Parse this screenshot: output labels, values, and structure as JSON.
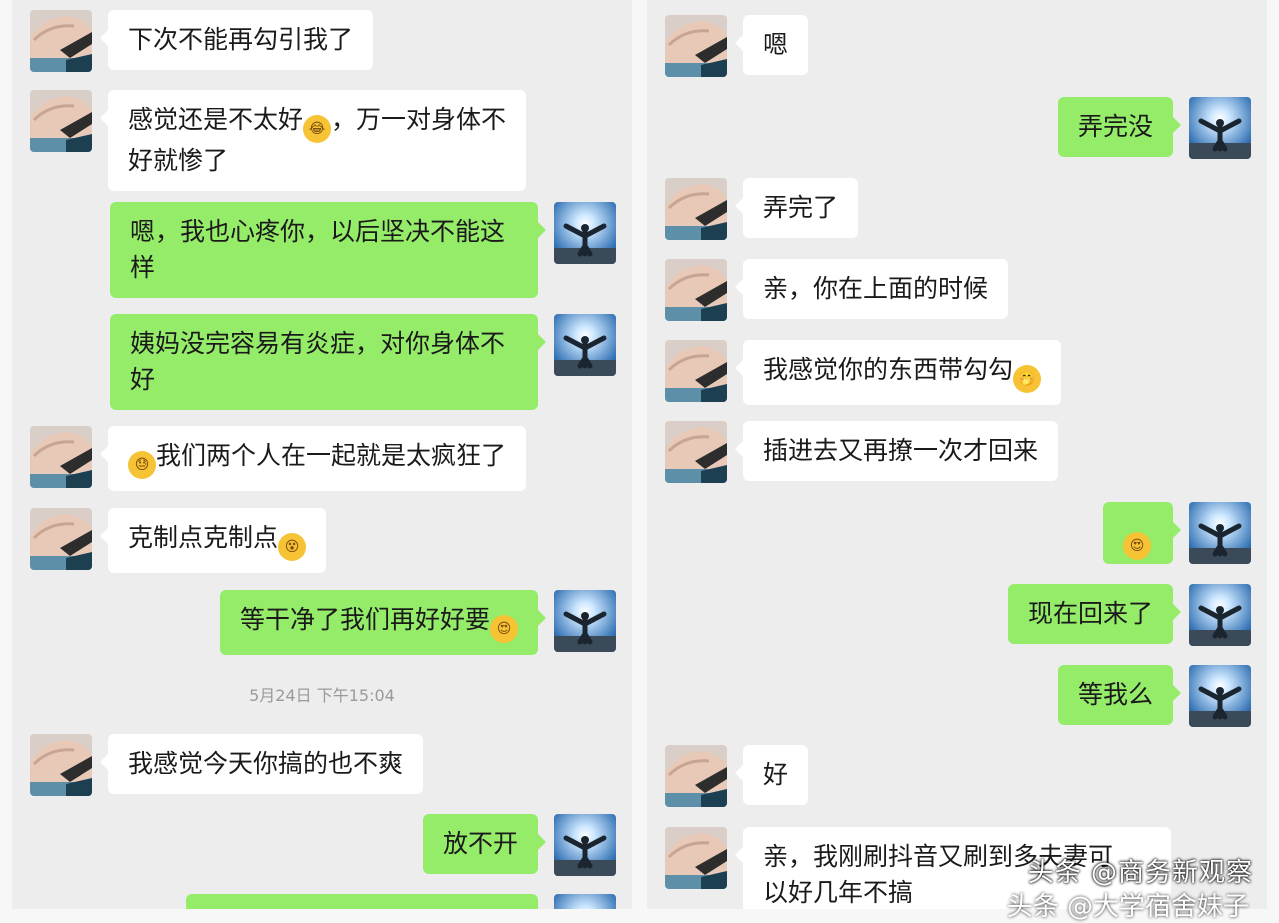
{
  "left": {
    "messages": [
      {
        "dir": "in",
        "text": "下次不能再勾引我了"
      },
      {
        "dir": "in",
        "text": "感觉还是不太好",
        "emoji": "laugh-cry-emoji",
        "text2": "，万一对身体不\n好就惨了"
      },
      {
        "dir": "out",
        "text": "嗯，我也心疼你，以后坚决不能这\n样"
      },
      {
        "dir": "out",
        "text": "姨妈没完容易有炎症，对你身体不\n好"
      },
      {
        "dir": "in",
        "emoji_lead": "sweat-emoji",
        "text": "我们两个人在一起就是太疯狂了"
      },
      {
        "dir": "in",
        "text": "克制点克制点",
        "emoji": "dizzy-emoji"
      },
      {
        "dir": "out",
        "text": "等干净了我们再好好要",
        "emoji": "heart-eyes-emoji"
      },
      {
        "dir": "in",
        "text": "我感觉今天你搞的也不爽"
      },
      {
        "dir": "out",
        "text": "放不开"
      }
    ],
    "timestamp": "5月24日 下午15:04"
  },
  "right": {
    "messages": [
      {
        "dir": "in",
        "text": "嗯"
      },
      {
        "dir": "out",
        "text": "弄完没"
      },
      {
        "dir": "in",
        "text": "弄完了"
      },
      {
        "dir": "in",
        "text": "亲，你在上面的时候"
      },
      {
        "dir": "in",
        "text": "我感觉你的东西带勾勾",
        "emoji": "shy-emoji"
      },
      {
        "dir": "in",
        "text": "插进去又再撩一次才回来"
      },
      {
        "dir": "out",
        "text": "",
        "emoji": "heart-eyes-emoji"
      },
      {
        "dir": "out",
        "text": "现在回来了"
      },
      {
        "dir": "out",
        "text": "等我么"
      },
      {
        "dir": "in",
        "text": "好"
      },
      {
        "dir": "in",
        "text": "亲，我刚刷抖音又刷到多夫妻可\n以好几年不搞"
      }
    ]
  },
  "watermark": "头条 @商务新观察",
  "watermark2": "头条 @大学宿舍妹子",
  "colors": {
    "incoming_bubble": "#ffffff",
    "outgoing_bubble": "#95ec69",
    "panel_bg": "#ededed"
  }
}
